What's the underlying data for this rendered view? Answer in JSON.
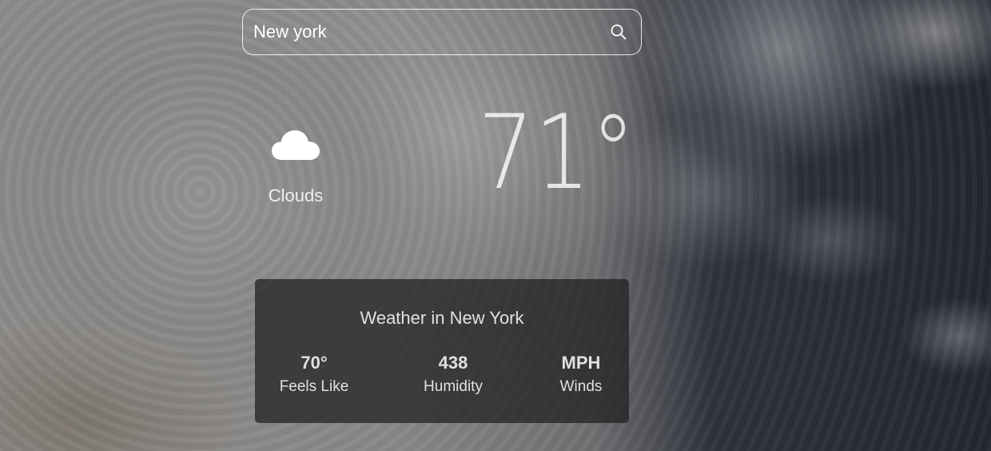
{
  "search": {
    "value": "New york",
    "icon": "search-icon"
  },
  "current": {
    "condition": "Clouds",
    "icon": "cloud-icon",
    "temperature": "71°"
  },
  "details": {
    "title": "Weather in New York",
    "stats": [
      {
        "value": "70°",
        "label": "Feels Like"
      },
      {
        "value": "438",
        "label": "Humidity"
      },
      {
        "value": "MPH",
        "label": "Winds"
      }
    ]
  },
  "colors": {
    "card_background": "#1e1e20",
    "text": "#ffffff"
  }
}
